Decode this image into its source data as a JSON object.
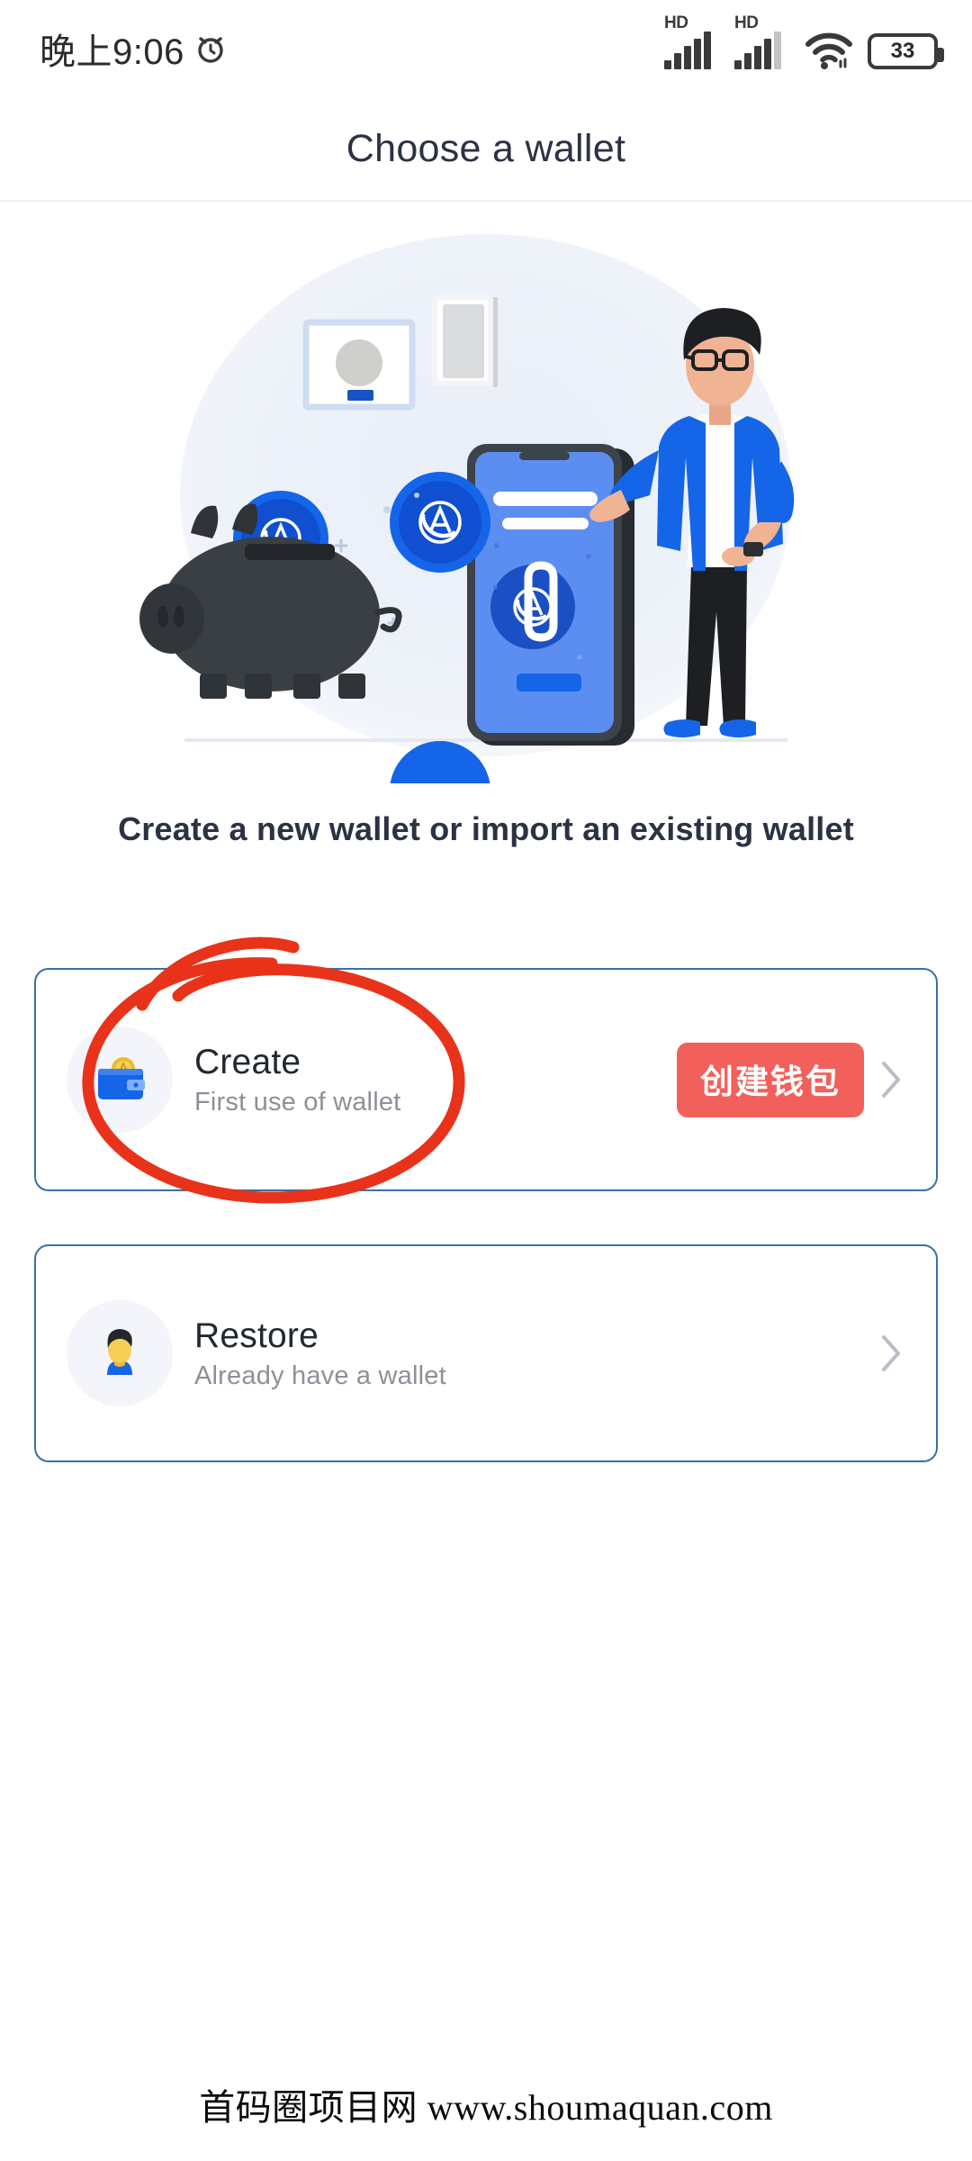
{
  "status_bar": {
    "time": "晚上9:06",
    "alarm_icon": "alarm-clock-icon",
    "signal_1_label": "HD",
    "signal_2_label": "HD",
    "wifi_icon": "wifi-icon",
    "battery_level": "33"
  },
  "header": {
    "title": "Choose a wallet"
  },
  "illustration": {
    "name": "wallet-onboarding-illustration",
    "piggy_bank": "piggy-bank",
    "coin_symbol": "A",
    "phone": "smartphone-mockup",
    "person": "man-with-glasses"
  },
  "main": {
    "subtitle": "Create a new wallet or import an existing wallet",
    "options": [
      {
        "id": "create",
        "icon": "wallet-coin-icon",
        "title": "Create",
        "subtitle": "First use of wallet",
        "badge": "创建钱包",
        "chevron": "chevron-right-icon"
      },
      {
        "id": "restore",
        "icon": "person-avatar-icon",
        "title": "Restore",
        "subtitle": "Already have a wallet",
        "badge": "",
        "chevron": "chevron-right-icon"
      }
    ]
  },
  "annotation": {
    "name": "red-circle-highlight",
    "target": "create",
    "color": "#E8331A"
  },
  "watermark": {
    "text": "首码圈项目网 www.shoumaquan.com"
  },
  "colors": {
    "card_border": "#3B6FA8",
    "badge_bg": "#F2605C",
    "title_text": "#2B3243",
    "sub_text": "#8C9199",
    "annotation_red": "#E8331A",
    "brand_blue": "#1565E8"
  }
}
